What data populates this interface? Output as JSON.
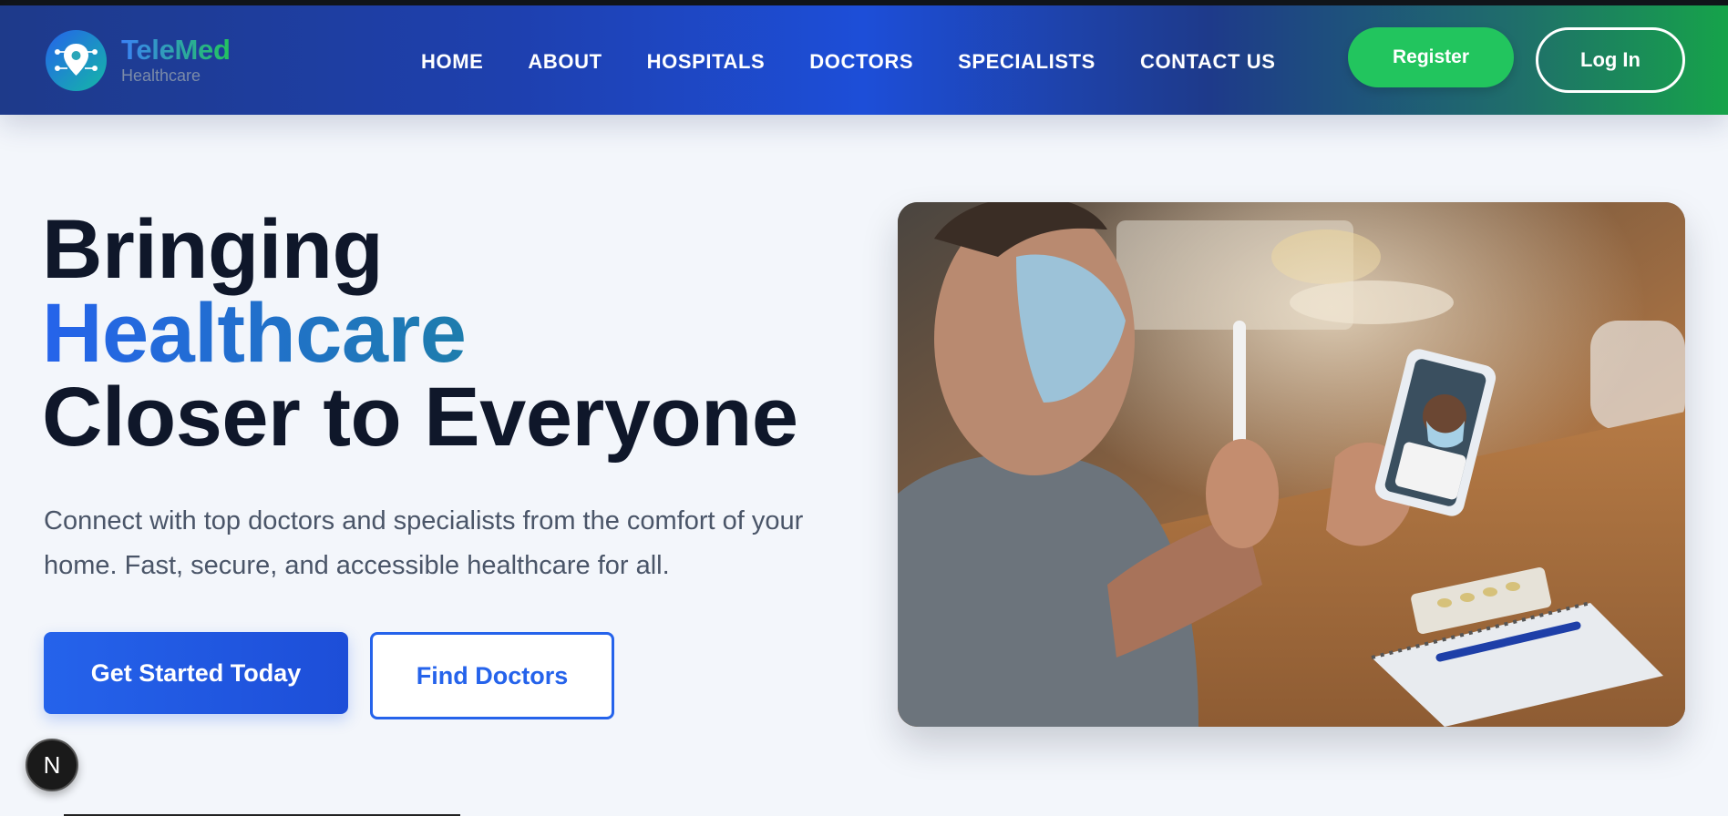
{
  "brand": {
    "name": "TeleMed",
    "tagline": "Healthcare",
    "logo_icon": "location-pin-network-icon"
  },
  "nav": {
    "items": [
      {
        "label": "HOME"
      },
      {
        "label": "ABOUT"
      },
      {
        "label": "HOSPITALS"
      },
      {
        "label": "DOCTORS"
      },
      {
        "label": "SPECIALISTS"
      },
      {
        "label": "CONTACT US"
      }
    ],
    "register_label": "Register",
    "login_label": "Log In"
  },
  "hero": {
    "title_line1": "Bringing",
    "title_accent": "Healthcare",
    "title_line3": "Closer to Everyone",
    "description": "Connect with top doctors and specialists from the comfort of your home. Fast, secure, and accessible healthcare for all.",
    "primary_cta": "Get Started Today",
    "secondary_cta": "Find Doctors",
    "image_subject": "man-with-mask-video-call-doctor-photo"
  },
  "dev_badge": {
    "label": "N"
  },
  "colors": {
    "nav_gradient_start": "#1e3a8a",
    "nav_gradient_end": "#16a34a",
    "primary": "#2563eb",
    "register_green": "#22c55e",
    "heading": "#0f172a",
    "body_text": "#4a5568",
    "page_bg": "#f3f6fb"
  }
}
